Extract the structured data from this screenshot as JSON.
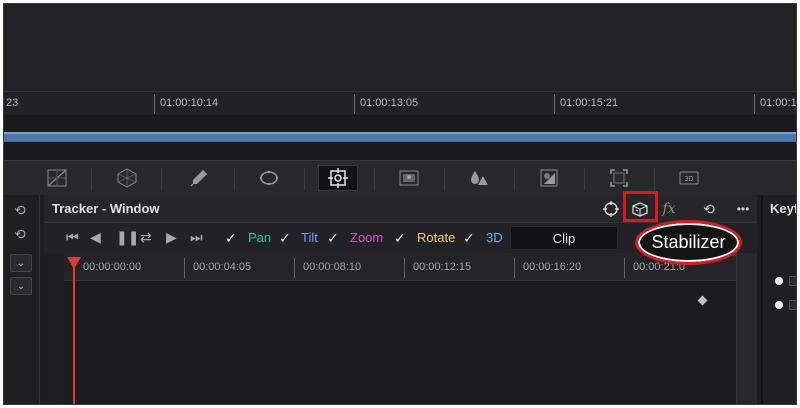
{
  "top_timeline": {
    "ticks": [
      "23",
      "01:00:10:14",
      "01:00:13:05",
      "01:00:15:21",
      "01:00:1"
    ]
  },
  "toolbar": {
    "tools": [
      "curves-icon",
      "color-warper-icon",
      "qualifier-picker-icon",
      "window-icon",
      "tracker-icon",
      "magic-mask-icon",
      "blur-icon",
      "key-icon",
      "sizing-icon",
      "3d-icon"
    ],
    "three_d_label": "3D"
  },
  "tracker": {
    "title": "Tracker - Window",
    "header_icons": [
      "crosshair-icon",
      "stabilizer-icon",
      "fx-icon",
      "reset-icon",
      "more-icon"
    ],
    "more_label": "•••",
    "transport": [
      "go-to-start",
      "track-backward",
      "pause",
      "track-bidirectional",
      "track-forward",
      "go-to-end"
    ],
    "checks": [
      {
        "label": "Pan",
        "color": "#2fc1a5"
      },
      {
        "label": "Tilt",
        "color": "#6aa1ff"
      },
      {
        "label": "Zoom",
        "color": "#d94fd3"
      },
      {
        "label": "Rotate",
        "color": "#e8d469"
      },
      {
        "label": "3D",
        "color": "#5fb6e8"
      }
    ],
    "mode_button": "Clip",
    "ruler_ticks": [
      "00:00:00:00",
      "00:00:04:05",
      "00:00:08:10",
      "00:00:12:15",
      "00:00:16:20",
      "00:00:21:0"
    ]
  },
  "left_column": {
    "dropdowns": [
      "⌄",
      "⌄"
    ]
  },
  "keyframes_panel": {
    "title": "Keyf"
  },
  "callout": {
    "label": "Stabilizer"
  }
}
